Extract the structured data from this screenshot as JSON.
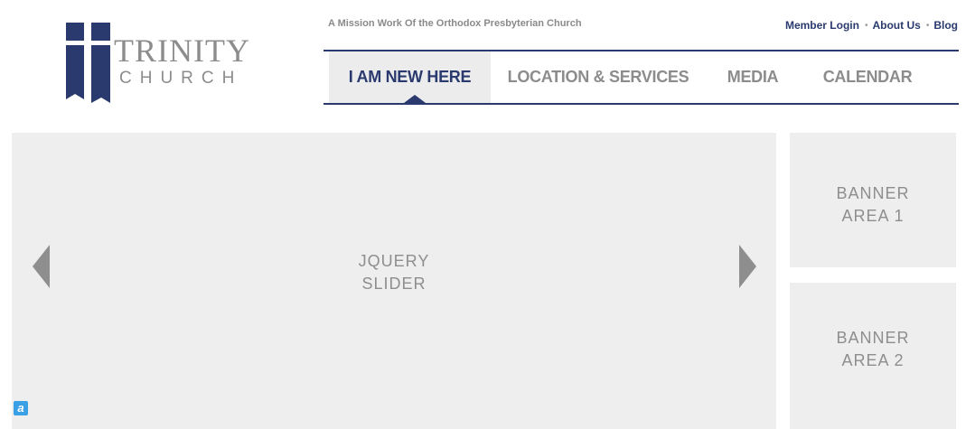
{
  "brand": {
    "name_line1": "TRINITY",
    "name_line2": "CHURCH",
    "color_primary": "#2a3a6e",
    "color_gray": "#8c8c8c"
  },
  "header": {
    "tagline": "A Mission Work Of the Orthodox Presbyterian Church",
    "utility_links": [
      "Member Login",
      "About Us",
      "Blog"
    ]
  },
  "nav": {
    "items": [
      {
        "label": "I AM NEW HERE",
        "active": true
      },
      {
        "label": "LOCATION & SERVICES",
        "active": false
      },
      {
        "label": "MEDIA",
        "active": false
      },
      {
        "label": "CALENDAR",
        "active": false
      }
    ]
  },
  "slider": {
    "label_line1": "JQUERY",
    "label_line2": "SLIDER",
    "prev_icon": "triangle-left-icon",
    "next_icon": "triangle-right-icon"
  },
  "banners": [
    {
      "line1": "BANNER",
      "line2": "AREA 1"
    },
    {
      "line1": "BANNER",
      "line2": "AREA 2"
    }
  ],
  "widget": {
    "glyph": "a"
  }
}
